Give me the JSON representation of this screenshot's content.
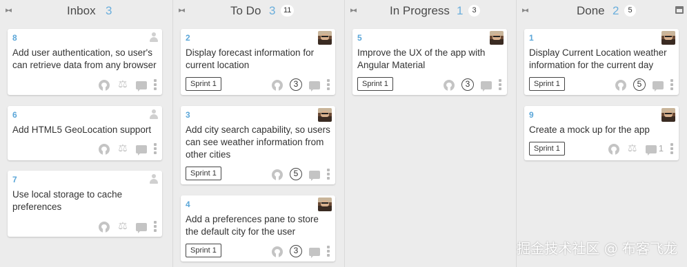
{
  "columns": [
    {
      "title": "Inbox",
      "count": "3",
      "badge": ""
    },
    {
      "title": "To Do",
      "count": "3",
      "badge": "11"
    },
    {
      "title": "In Progress",
      "count": "1",
      "badge": "3"
    },
    {
      "title": "Done",
      "count": "2",
      "badge": "5"
    }
  ],
  "cards": {
    "inbox": [
      {
        "number": "8",
        "title": "Add user authentication, so user's can retrieve data from any browser"
      },
      {
        "number": "6",
        "title": "Add HTML5 GeoLocation support"
      },
      {
        "number": "7",
        "title": "Use local storage to cache preferences"
      }
    ],
    "todo": [
      {
        "number": "2",
        "title": "Display forecast information for current location",
        "sprint": "Sprint 1",
        "points": "3"
      },
      {
        "number": "3",
        "title": "Add city search capability, so users can see weather information from other cities",
        "sprint": "Sprint 1",
        "points": "5"
      },
      {
        "number": "4",
        "title": "Add a preferences pane to store the default city for the user",
        "sprint": "Sprint 1",
        "points": "3"
      }
    ],
    "inprogress": [
      {
        "number": "5",
        "title": "Improve the UX of the app with Angular Material",
        "sprint": "Sprint 1",
        "points": "3"
      }
    ],
    "done": [
      {
        "number": "1",
        "title": "Display Current Location weather information for the current day",
        "sprint": "Sprint 1",
        "points": "5"
      },
      {
        "number": "9",
        "title": "Create a mock up for the app",
        "sprint": "Sprint 1",
        "comments": "1"
      }
    ]
  },
  "icons": {
    "collapse": "collapse-arrows-icon",
    "archive": "archive-icon",
    "github": "github-icon",
    "estimate": "scale-icon",
    "comment": "comment-icon",
    "menu": "more-vertical-icon"
  },
  "watermark": "掘金技术社区 @ 布客飞龙",
  "colors": {
    "accent": "#5aa6d8",
    "board_bg": "#ececec",
    "card_bg": "#ffffff"
  }
}
